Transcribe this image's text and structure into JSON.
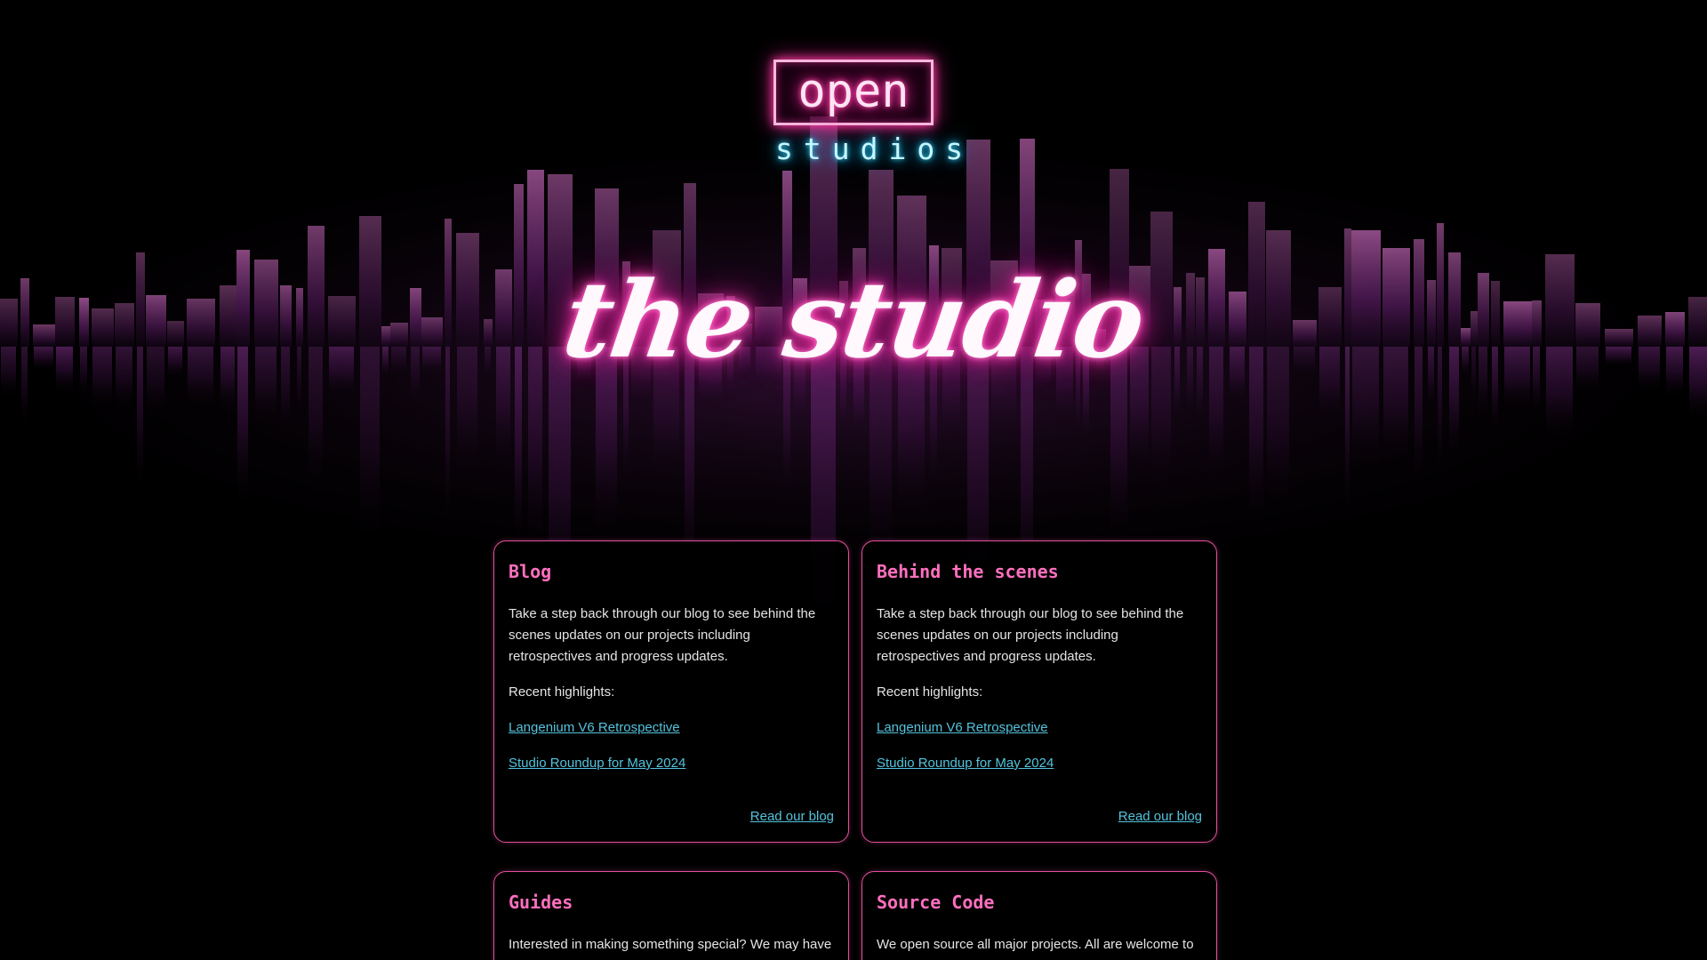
{
  "logo": {
    "word": "open",
    "sub": "studios"
  },
  "hero": {
    "title": "the studio"
  },
  "cards": [
    {
      "title": "Blog",
      "description": "Take a step back through our blog to see behind the scenes updates on our projects including retrospectives and progress updates.",
      "highlights_label": "Recent highlights:",
      "links": [
        "Langenium V6 Retrospective",
        "Studio Roundup for May 2024"
      ],
      "action": "Read our blog"
    },
    {
      "title": "Behind the scenes",
      "description": "Take a step back through our blog to see behind the scenes updates on our projects including retrospectives and progress updates.",
      "highlights_label": "Recent highlights:",
      "links": [
        "Langenium V6 Retrospective",
        "Studio Roundup for May 2024"
      ],
      "action": "Read our blog"
    },
    {
      "title": "Guides",
      "description": "Interested in making something special? We may have"
    },
    {
      "title": "Source Code",
      "description": "We open source all major projects. All are welcome to"
    }
  ],
  "colors": {
    "background": "#000000",
    "accent_pink": "#ff6fbe",
    "accent_cyan": "#53c3dd",
    "card_border": "#e5509e"
  }
}
